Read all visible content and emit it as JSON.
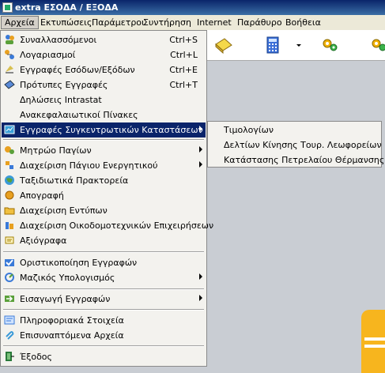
{
  "window": {
    "title": "extra ΕΣΟΔΑ / ΕΞΟΔΑ"
  },
  "menubar": {
    "items": [
      "Αρχεία",
      "Εκτυπώσεις",
      "Παράμετροι",
      "Συντήρηση",
      "Internet",
      "Παράθυρο",
      "Βοήθεια"
    ],
    "active": "Αρχεία"
  },
  "toolbar": {
    "icons": [
      "notebook-icon",
      "calculator-icon",
      "dropdown-arrow-icon",
      "gears-icon",
      "gears-icon"
    ]
  },
  "file_menu": {
    "items": [
      {
        "label": "Συναλλασσόμενοι",
        "shortcut": "Ctrl+S",
        "icon": "people-icon"
      },
      {
        "label": "Λογαριασμοί",
        "shortcut": "Ctrl+L",
        "icon": "accounts-icon"
      },
      {
        "label": "Εγγραφές Εσόδων/Εξόδων",
        "shortcut": "Ctrl+E",
        "icon": "entries-icon"
      },
      {
        "label": "Πρότυπες Εγγραφές",
        "shortcut": "Ctrl+T",
        "icon": "template-icon"
      },
      {
        "label": "Δηλώσεις Intrastat"
      },
      {
        "label": "Ανακεφαλαιωτικοί Πίνακες"
      },
      {
        "label": "Εγγραφές Συγκεντρωτικών Καταστάσεων",
        "submenu": true,
        "icon": "summary-icon"
      },
      {
        "label": "Μητρώο Παγίων",
        "submenu": true,
        "icon": "assets-icon"
      },
      {
        "label": "Διαχείριση Πάγιου Ενεργητικού",
        "submenu": true,
        "icon": "fixed-assets-icon"
      },
      {
        "label": "Ταξιδιωτικά Πρακτορεία",
        "icon": "globe-icon"
      },
      {
        "label": "Απογραφή",
        "icon": "inventory-icon"
      },
      {
        "label": "Διαχείριση Εντύπων",
        "icon": "folder-icon"
      },
      {
        "label": "Διαχείριση Οικοδομοτεχνικών Επιχειρήσεων",
        "icon": "construction-icon"
      },
      {
        "label": "Αξιόγραφα",
        "icon": "securities-icon"
      },
      {
        "label": "Οριστικοποίηση Εγγραφών",
        "icon": "finalize-icon"
      },
      {
        "label": "Μαζικός Υπολογισμός",
        "submenu": true,
        "icon": "mass-calc-icon"
      },
      {
        "label": "Εισαγωγή Εγγραφών",
        "submenu": true,
        "icon": "import-icon"
      },
      {
        "label": "Πληροφοριακά Στοιχεία",
        "icon": "info-icon"
      },
      {
        "label": "Επισυναπτόμενα Αρχεία",
        "icon": "attachment-icon"
      },
      {
        "label": "Έξοδος",
        "icon": "exit-icon"
      }
    ]
  },
  "submenu": {
    "items": [
      "Τιμολογίων",
      "Δελτίων Κίνησης Τουρ. Λεωφορείων",
      "Κατάστασης Πετρελαίου Θέρμανσης"
    ]
  }
}
